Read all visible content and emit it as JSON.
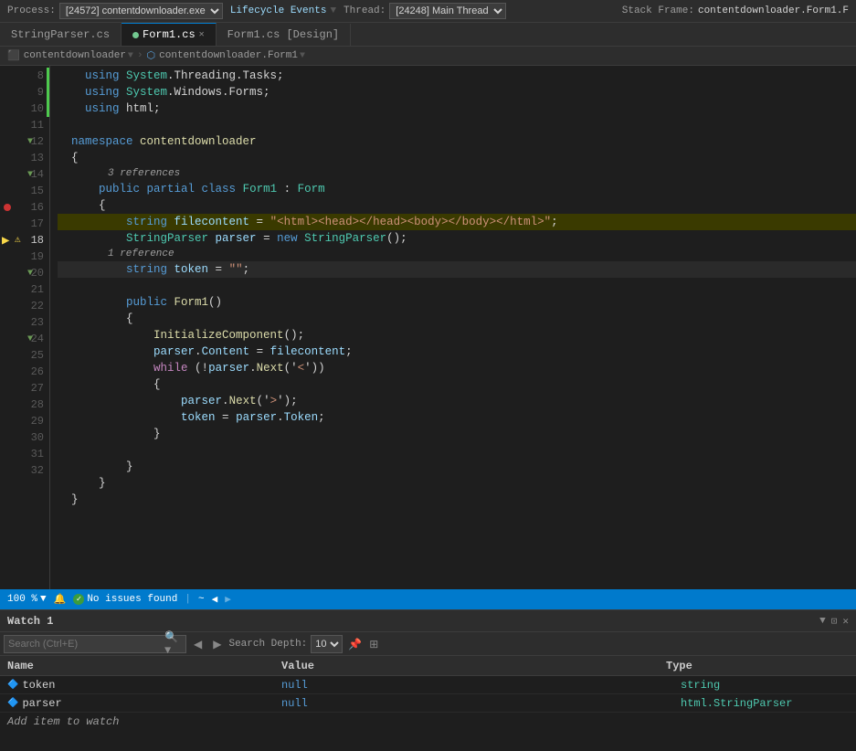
{
  "topbar": {
    "process_label": "Process:",
    "process_value": "[24572] contentdownloader.exe",
    "lifecycle_label": "Lifecycle Events",
    "thread_label": "Thread:",
    "thread_value": "[24248] Main Thread",
    "stackframe_label": "Stack Frame:",
    "stackframe_value": "contentdownloader.Form1.F"
  },
  "tabs": [
    {
      "id": "stringparser",
      "label": "StringParser.cs",
      "active": false,
      "modified": false
    },
    {
      "id": "form1cs",
      "label": "Form1.cs",
      "active": true,
      "modified": true
    },
    {
      "id": "form1design",
      "label": "Form1.cs [Design]",
      "active": false,
      "modified": false
    }
  ],
  "breadcrumb": {
    "left": "contentdownloader",
    "right": "contentdownloader.Form1"
  },
  "code": {
    "lines": [
      {
        "num": 8,
        "text": "    using System.Threading.Tasks;",
        "indent": 0
      },
      {
        "num": 9,
        "text": "    using System.Windows.Forms;",
        "indent": 0
      },
      {
        "num": 10,
        "text": "    using html;",
        "indent": 0
      },
      {
        "num": 11,
        "text": ""
      },
      {
        "num": 12,
        "text": "  namespace contentdownloader",
        "indent": 0,
        "collapsible": true
      },
      {
        "num": 13,
        "text": "  {",
        "indent": 0
      },
      {
        "num": 14,
        "text": "      public partial class Form1 : Form",
        "indent": 0,
        "collapsible": true,
        "ref": "3 references"
      },
      {
        "num": 15,
        "text": "      {",
        "indent": 0
      },
      {
        "num": 16,
        "text": "          string filecontent = \"<html><head></head><body></body></html>\";",
        "indent": 0,
        "highlight": true,
        "breakpoint": true
      },
      {
        "num": 17,
        "text": "          StringParser parser = new StringParser();",
        "indent": 0
      },
      {
        "num": 18,
        "text": "          string token = \"\";",
        "indent": 0,
        "current": true,
        "warn": true,
        "ref": "1 reference"
      },
      {
        "num": 19,
        "text": ""
      },
      {
        "num": 20,
        "text": "          public Form1()",
        "indent": 0,
        "collapsible": true
      },
      {
        "num": 21,
        "text": "          {",
        "indent": 0
      },
      {
        "num": 22,
        "text": "              InitializeComponent();",
        "indent": 0
      },
      {
        "num": 23,
        "text": "              parser.Content = filecontent;",
        "indent": 0
      },
      {
        "num": 24,
        "text": "              while (!parser.Next('<'))",
        "indent": 0,
        "collapsible": true
      },
      {
        "num": 25,
        "text": "              {",
        "indent": 0
      },
      {
        "num": 26,
        "text": "                  parser.Next('>');",
        "indent": 0
      },
      {
        "num": 27,
        "text": "                  token = parser.Token;",
        "indent": 0
      },
      {
        "num": 28,
        "text": "              }",
        "indent": 0
      },
      {
        "num": 29,
        "text": ""
      },
      {
        "num": 30,
        "text": "          }",
        "indent": 0
      },
      {
        "num": 31,
        "text": "      }",
        "indent": 0
      },
      {
        "num": 32,
        "text": "  }",
        "indent": 0
      }
    ]
  },
  "statusbar": {
    "zoom": "100 %",
    "issues_check": "✓",
    "issues_text": "No issues found",
    "squiggle": "~"
  },
  "watch": {
    "title": "Watch 1",
    "search_placeholder": "Search (Ctrl+E)",
    "depth_label": "Search Depth:",
    "depth_value": "10",
    "columns": {
      "name": "Name",
      "value": "Value",
      "type": "Type"
    },
    "rows": [
      {
        "name": "token",
        "value": "null",
        "type": "string"
      },
      {
        "name": "parser",
        "value": "null",
        "type": "html.StringParser"
      }
    ],
    "add_item_label": "Add item to watch"
  }
}
